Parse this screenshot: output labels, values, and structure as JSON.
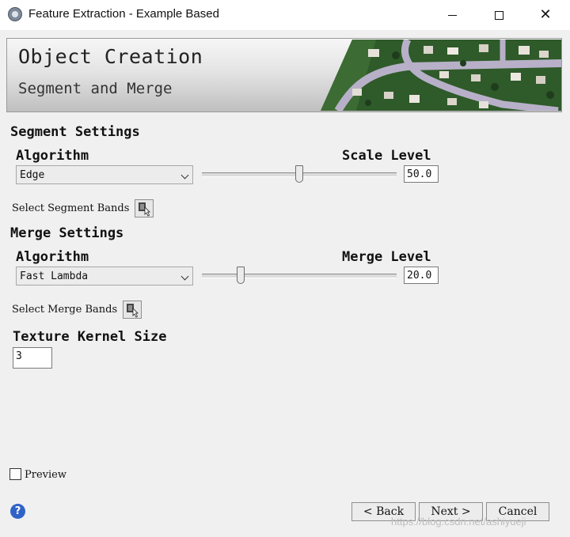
{
  "window": {
    "title": "Feature Extraction - Example Based",
    "controls": {
      "minimize": "minimize-icon",
      "maximize": "maximize-icon",
      "close": "close-icon",
      "close_glyph": "✕"
    }
  },
  "banner": {
    "title": "Object Creation",
    "subtitle": "Segment and Merge"
  },
  "segment": {
    "section_title": "Segment Settings",
    "algorithm_label": "Algorithm",
    "algorithm_value": "Edge",
    "level_label": "Scale Level",
    "level_value": "50.0",
    "level_fraction": 0.5,
    "bands_label": "Select Segment Bands"
  },
  "merge": {
    "section_title": "Merge Settings",
    "algorithm_label": "Algorithm",
    "algorithm_value": "Fast Lambda",
    "level_label": "Merge Level",
    "level_value": "20.0",
    "level_fraction": 0.2,
    "bands_label": "Select Merge Bands"
  },
  "texture": {
    "label": "Texture Kernel Size",
    "value": "3"
  },
  "preview": {
    "label": "Preview",
    "checked": false
  },
  "footer": {
    "help_glyph": "?",
    "back_label": "< Back",
    "next_label": "Next >",
    "cancel_label": "Cancel",
    "watermark": "https://blog.csdn.net/ashiyueji"
  },
  "colors": {
    "help_blue": "#2f63c7",
    "road": "#b8b0c8",
    "lawn": "#2f5a2a"
  }
}
